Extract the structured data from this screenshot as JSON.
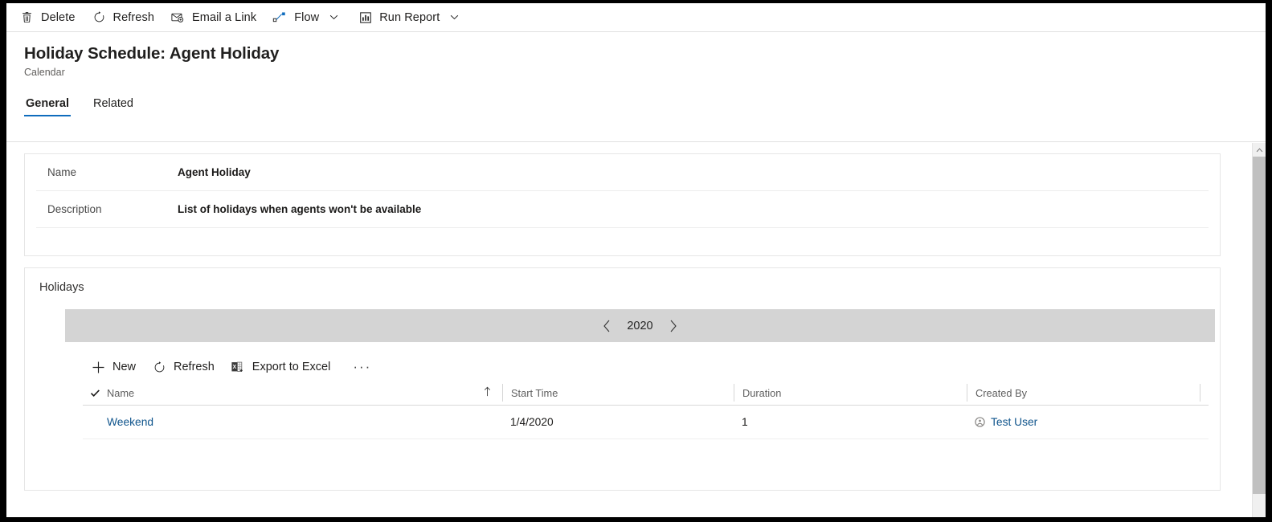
{
  "command_bar": {
    "items": [
      {
        "icon": "trash-icon",
        "label": "Delete",
        "caret": false
      },
      {
        "icon": "refresh-icon",
        "label": "Refresh",
        "caret": false
      },
      {
        "icon": "email-link-icon",
        "label": "Email a Link",
        "caret": false
      },
      {
        "icon": "flow-icon",
        "label": "Flow",
        "caret": true
      },
      {
        "icon": "report-icon",
        "label": "Run Report",
        "caret": true
      }
    ]
  },
  "header": {
    "title": "Holiday Schedule: Agent Holiday",
    "subtitle": "Calendar",
    "tabs": [
      {
        "label": "General",
        "active": true
      },
      {
        "label": "Related",
        "active": false
      }
    ]
  },
  "general_section": {
    "fields": [
      {
        "label": "Name",
        "value": "Agent Holiday"
      },
      {
        "label": "Description",
        "value": "List of holidays when agents won't be available"
      }
    ]
  },
  "holidays_section": {
    "title": "Holidays",
    "year_nav": {
      "prev_icon": "chevron-left-icon",
      "year": "2020",
      "next_icon": "chevron-right-icon"
    },
    "toolbar": [
      {
        "icon": "add-icon",
        "label": "New"
      },
      {
        "icon": "refresh-icon",
        "label": "Refresh"
      },
      {
        "icon": "excel-icon",
        "label": "Export to Excel"
      }
    ],
    "overflow_label": "···",
    "grid": {
      "columns": [
        {
          "key": "name",
          "label": "Name",
          "sorted": true,
          "sort_icon": "sort-ascending-arrow"
        },
        {
          "key": "start",
          "label": "Start Time",
          "sorted": false
        },
        {
          "key": "duration",
          "label": "Duration",
          "sorted": false
        },
        {
          "key": "createdby",
          "label": "Created By",
          "sorted": false
        }
      ],
      "select_all_icon": "checkmark-icon",
      "rows": [
        {
          "name": "Weekend",
          "start": "1/4/2020",
          "duration": "1",
          "createdby": "Test User",
          "createdby_icon": "user-circle-icon"
        }
      ]
    }
  },
  "colors": {
    "accent": "#0f6cbd",
    "link": "#0f548c",
    "year_bar": "#d4d4d4",
    "scrollbar_thumb": "#c0c0c0"
  }
}
